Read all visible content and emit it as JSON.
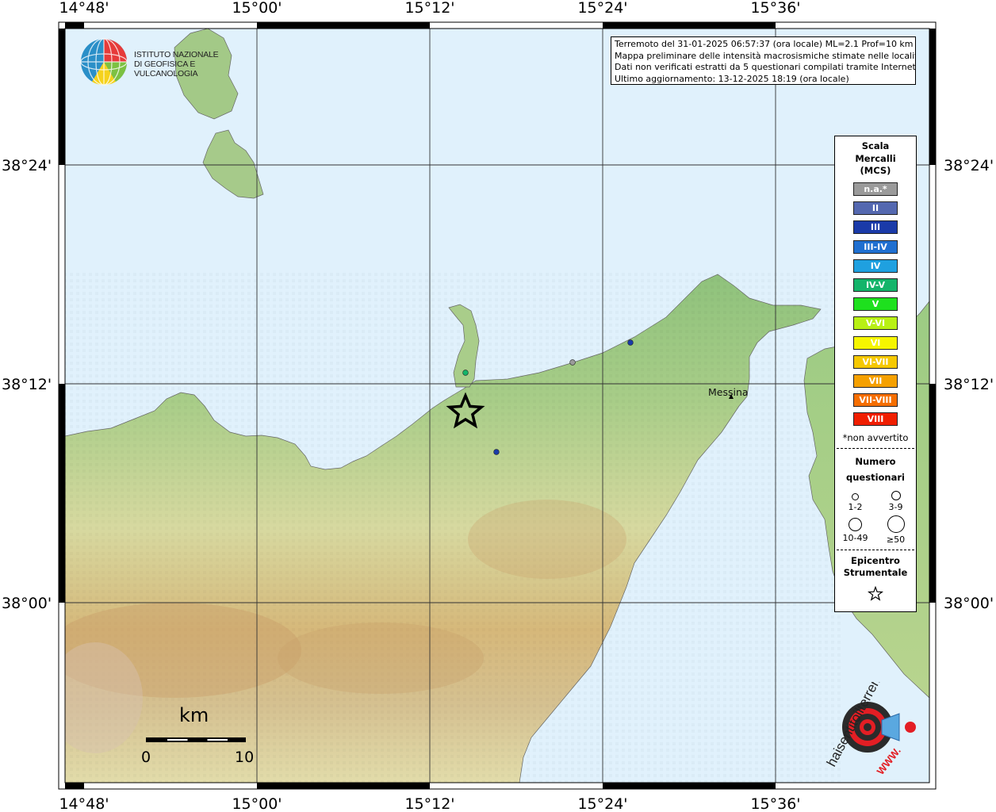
{
  "coords": {
    "top": [
      "14°48'",
      "15°00'",
      "15°12'",
      "15°24'",
      "15°36'"
    ],
    "bottom": [
      "14°48'",
      "15°00'",
      "15°12'",
      "15°24'",
      "15°36'"
    ],
    "left": [
      "38°24'",
      "38°12'",
      "38°00'"
    ],
    "right": [
      "38°24'",
      "38°12'",
      "38°00'"
    ]
  },
  "info": {
    "line1": "Terremoto del 31-01-2025 06:57:37 (ora locale) ML=2.1 Prof=10 km",
    "line2": "Mappa preliminare delle intensità macrosismiche stimate nelle località",
    "line3": "Dati non verificati estratti da 5 questionari compilati tramite Internet.",
    "line4": "Ultimo aggiornamento: 13-12-2025 18:19 (ora locale)"
  },
  "logo": {
    "line1": "ISTITUTO NAZIONALE",
    "line2": "DI GEOFISICA E VULCANOLOGIA"
  },
  "place_label": "Messina",
  "legend": {
    "title": [
      "Scala",
      "Mercalli",
      "(MCS)"
    ],
    "classes": [
      {
        "label": "n.a.*",
        "color": "#9a9a9a"
      },
      {
        "label": "II",
        "color": "#5468b0"
      },
      {
        "label": "III",
        "color": "#1a3aa8"
      },
      {
        "label": "III-IV",
        "color": "#1f6fd0"
      },
      {
        "label": "IV",
        "color": "#1fa0e0"
      },
      {
        "label": "IV-V",
        "color": "#14b46a"
      },
      {
        "label": "V",
        "color": "#1ee01e"
      },
      {
        "label": "V-VI",
        "color": "#b8f014"
      },
      {
        "label": "VI",
        "color": "#f5f500"
      },
      {
        "label": "VI-VII",
        "color": "#f5c800"
      },
      {
        "label": "VII",
        "color": "#f5a000"
      },
      {
        "label": "VII-VIII",
        "color": "#f56e00"
      },
      {
        "label": "VIII",
        "color": "#f01e00"
      }
    ],
    "note": "*non avvertito",
    "count_title": [
      "Numero",
      "questionari"
    ],
    "counts": [
      "1-2",
      "3-9",
      "10-49",
      "≥50"
    ],
    "epi_title": [
      "Epicentro",
      "Strumentale"
    ]
  },
  "scale": {
    "unit": "km",
    "min": "0",
    "max": "10"
  },
  "observations": [
    {
      "intensity": "IV-V",
      "color": "#14b46a"
    },
    {
      "intensity": "III",
      "color": "#1a3aa8"
    },
    {
      "intensity": "III",
      "color": "#1a3aa8"
    },
    {
      "intensity": "n.a.*",
      "color": "#9a9a9a"
    }
  ],
  "site": {
    "text": "haisentitoilterremoto.it",
    "url_text": "WWW."
  }
}
